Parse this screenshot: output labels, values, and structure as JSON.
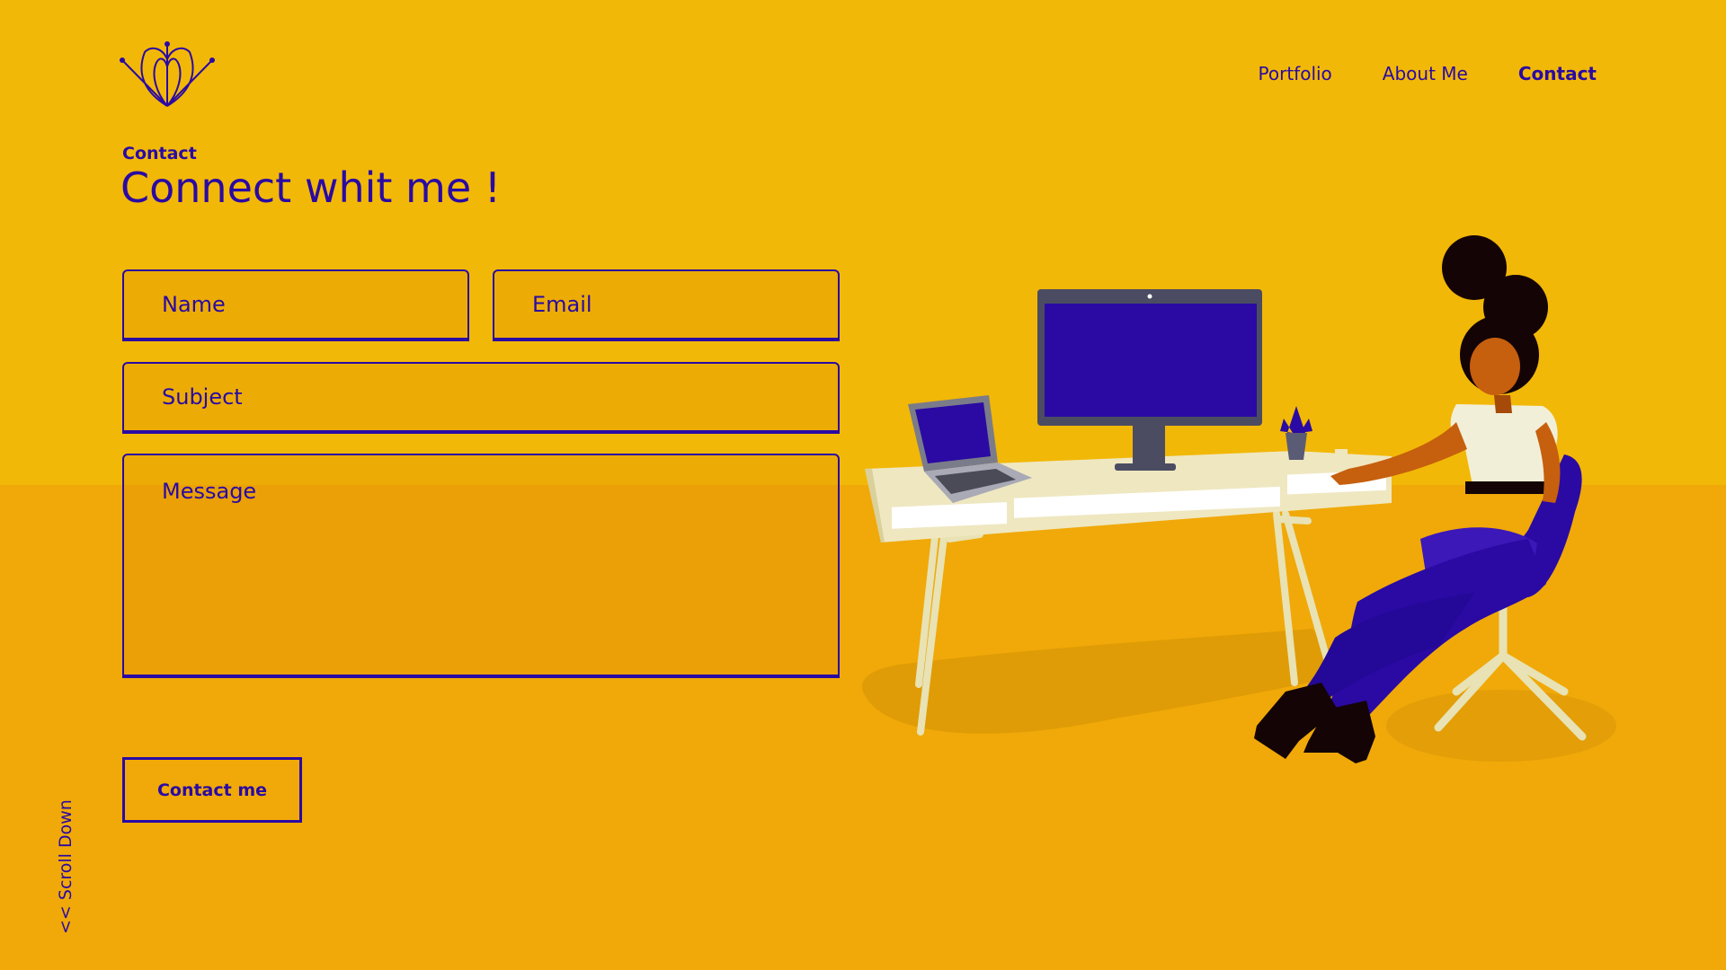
{
  "nav": {
    "items": [
      {
        "label": "Portfolio",
        "active": false
      },
      {
        "label": "About Me",
        "active": false
      },
      {
        "label": "Contact",
        "active": true
      }
    ]
  },
  "header": {
    "eyebrow": "Contact",
    "title": "Connect whit me !"
  },
  "form": {
    "name_placeholder": "Name",
    "email_placeholder": "Email",
    "subject_placeholder": "Subject",
    "message_placeholder": "Message",
    "submit_label": "Contact me"
  },
  "scroll_hint": "<< Scroll Down",
  "colors": {
    "background": "#F2B807",
    "floor": "#F0A908",
    "accent": "#2A0AA3"
  }
}
